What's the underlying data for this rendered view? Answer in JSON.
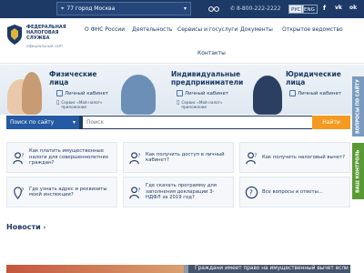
{
  "topbar": {
    "region": "77 город Москва",
    "phone": "8-800-222-2222",
    "lang_ru": "РУС",
    "lang_eng": "ENG",
    "social": [
      "f",
      "vk",
      "ok"
    ]
  },
  "logo": {
    "text": "ФЕДЕРАЛЬНАЯ НАЛОГОВАЯ СЛУЖБА",
    "sub": "официальный сайт"
  },
  "nav": [
    "О ФНС России",
    "Деятельность",
    "Сервисы и госуслуги",
    "Документы",
    "Открытое ведомство",
    "Контакты"
  ],
  "hero": {
    "categories": [
      {
        "title": "Физические лица",
        "cabinet": "Личный кабинет",
        "note": "Сервис «Мой налог»\nприложение"
      },
      {
        "title": "Индивидуальные предприниматели",
        "cabinet": "Личный кабинет",
        "note": "Сервис «Мой налог»\nприложение"
      },
      {
        "title": "Юридические лица",
        "cabinet": "Личный кабинет"
      }
    ]
  },
  "side_tabs": [
    "ВОПРОСЫ ПО САЙТУ",
    "ВАШ КОНТРОЛЬ"
  ],
  "search": {
    "button": "Поиск по сайту",
    "placeholder": "Поиск",
    "go": "Найти"
  },
  "cards": [
    {
      "icon": "person-question-icon",
      "text": "Как платить имущественные налоги для совершеннолетних граждан?"
    },
    {
      "icon": "person-question-icon",
      "text": "Как получить доступ в личный кабинет?"
    },
    {
      "icon": "person-question-icon",
      "text": "Как получить налоговый вычет?"
    },
    {
      "icon": "location-question-icon",
      "text": "Где узнать адрес и реквизиты моей инспекции?"
    },
    {
      "icon": "person-question-icon",
      "text": "Где скачать программу для заполнения декларации 3-НДФЛ за 2019 год?"
    },
    {
      "icon": "question-icon",
      "text": "Все вопросы и ответы..."
    }
  ],
  "news": {
    "title": "Новости",
    "banner": "Граждани имеет право на имущественный вычет если оплатил недвижимость через представителя"
  }
}
